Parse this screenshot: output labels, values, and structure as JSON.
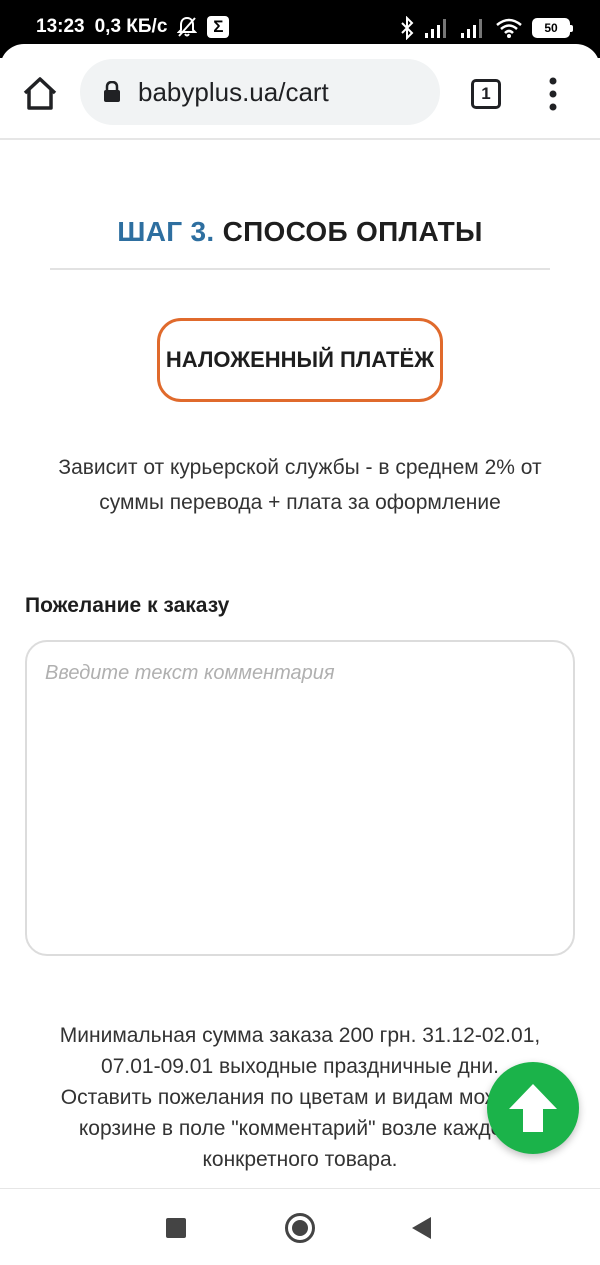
{
  "status_bar": {
    "time": "13:23",
    "speed": "0,3 КБ/с",
    "app_badge": "Σ",
    "battery": "50",
    "icons": [
      "mute-bell-icon",
      "bluetooth-icon",
      "signal-icon",
      "signal-icon",
      "wifi-icon",
      "battery-icon"
    ]
  },
  "browser": {
    "url": "babyplus.ua/cart",
    "tab_count": "1",
    "icons": [
      "home-icon",
      "lock-icon",
      "tabs-icon",
      "more-vert-icon"
    ]
  },
  "checkout": {
    "step_number": "ШАГ 3.",
    "step_title": "СПОСОБ ОПЛАТЫ",
    "payment_option": "НАЛОЖЕННЫЙ ПЛАТЁЖ",
    "payment_description": "Зависит от курьерской службы - в среднем 2% от суммы перевода + плата за оформление",
    "comment_label": "Пожелание к заказу",
    "comment_value": "",
    "comment_placeholder": "Введите текст комментария",
    "info_line1": "Минимальная сумма заказа 200 грн. 31.12-02.01, 07.01-09.01 выходные праздничные дни.",
    "info_line2": "Оставить пожелания по цветам и видам можно в корзине в поле \"комментарий\" возле каждого конкретного товара."
  },
  "colors": {
    "step_accent": "#2e6fa0",
    "option_border": "#e06a2c",
    "scroll_button": "#1bb34a"
  }
}
